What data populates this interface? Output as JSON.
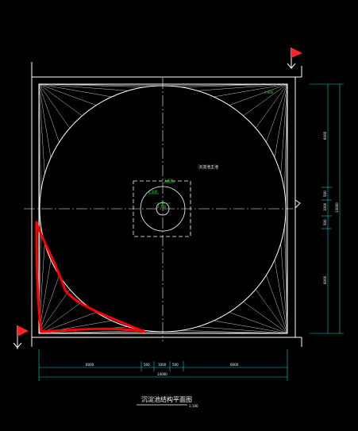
{
  "drawing": {
    "title": "沉淀池结构平面图",
    "scale": "1:100",
    "tank_label": "沉淀池主池",
    "center_marks": [
      "3.600",
      "3.300",
      "2.700"
    ],
    "corner_mark": "3.600",
    "bottom_dims": [
      "6000",
      "500",
      "1000",
      "500",
      "6000",
      "14000"
    ],
    "right_dims": [
      "6000",
      "500",
      "1000",
      "500",
      "6000",
      "14000"
    ]
  },
  "colors": {
    "background": "#000000",
    "lines": "#ffffff",
    "dim_lines": "#00d0d0",
    "annotation": "#33dd33",
    "markup": "#ff0000",
    "flag": "#ff2222"
  }
}
